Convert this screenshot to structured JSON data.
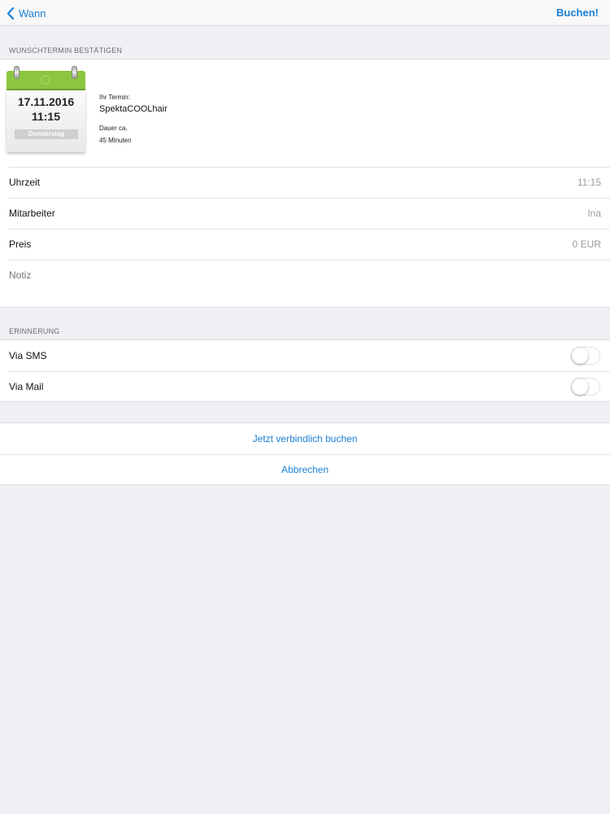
{
  "navbar": {
    "back_label": "Wann",
    "action_label": "Buchen!"
  },
  "confirm_section": {
    "header": "WUNSCHTERMIN BESTÄTIGEN",
    "calendar": {
      "date": "17.11.2016",
      "time": "11:15",
      "weekday": "Donnerstag"
    },
    "appointment_label": "Ihr Termin:",
    "salon_name": "SpektaCOOLhair",
    "duration_label": "Dauer ca.",
    "duration_value": "45 Minuten",
    "rows": [
      {
        "label": "Uhrzeit",
        "value": "11:15"
      },
      {
        "label": "Mitarbeiter",
        "value": "Ina"
      },
      {
        "label": "Preis",
        "value": "0 EUR"
      }
    ],
    "note_placeholder": "Notiz"
  },
  "reminder_section": {
    "header": "ERINNERUNG",
    "options": [
      {
        "label": "Via SMS",
        "enabled": false
      },
      {
        "label": "Via Mail",
        "enabled": false
      }
    ]
  },
  "actions": {
    "book_label": "Jetzt verbindlich buchen",
    "cancel_label": "Abbrechen"
  },
  "colors": {
    "accent": "#1a7fd6",
    "calendar_green": "#8cc63f",
    "background": "#efeff4"
  }
}
